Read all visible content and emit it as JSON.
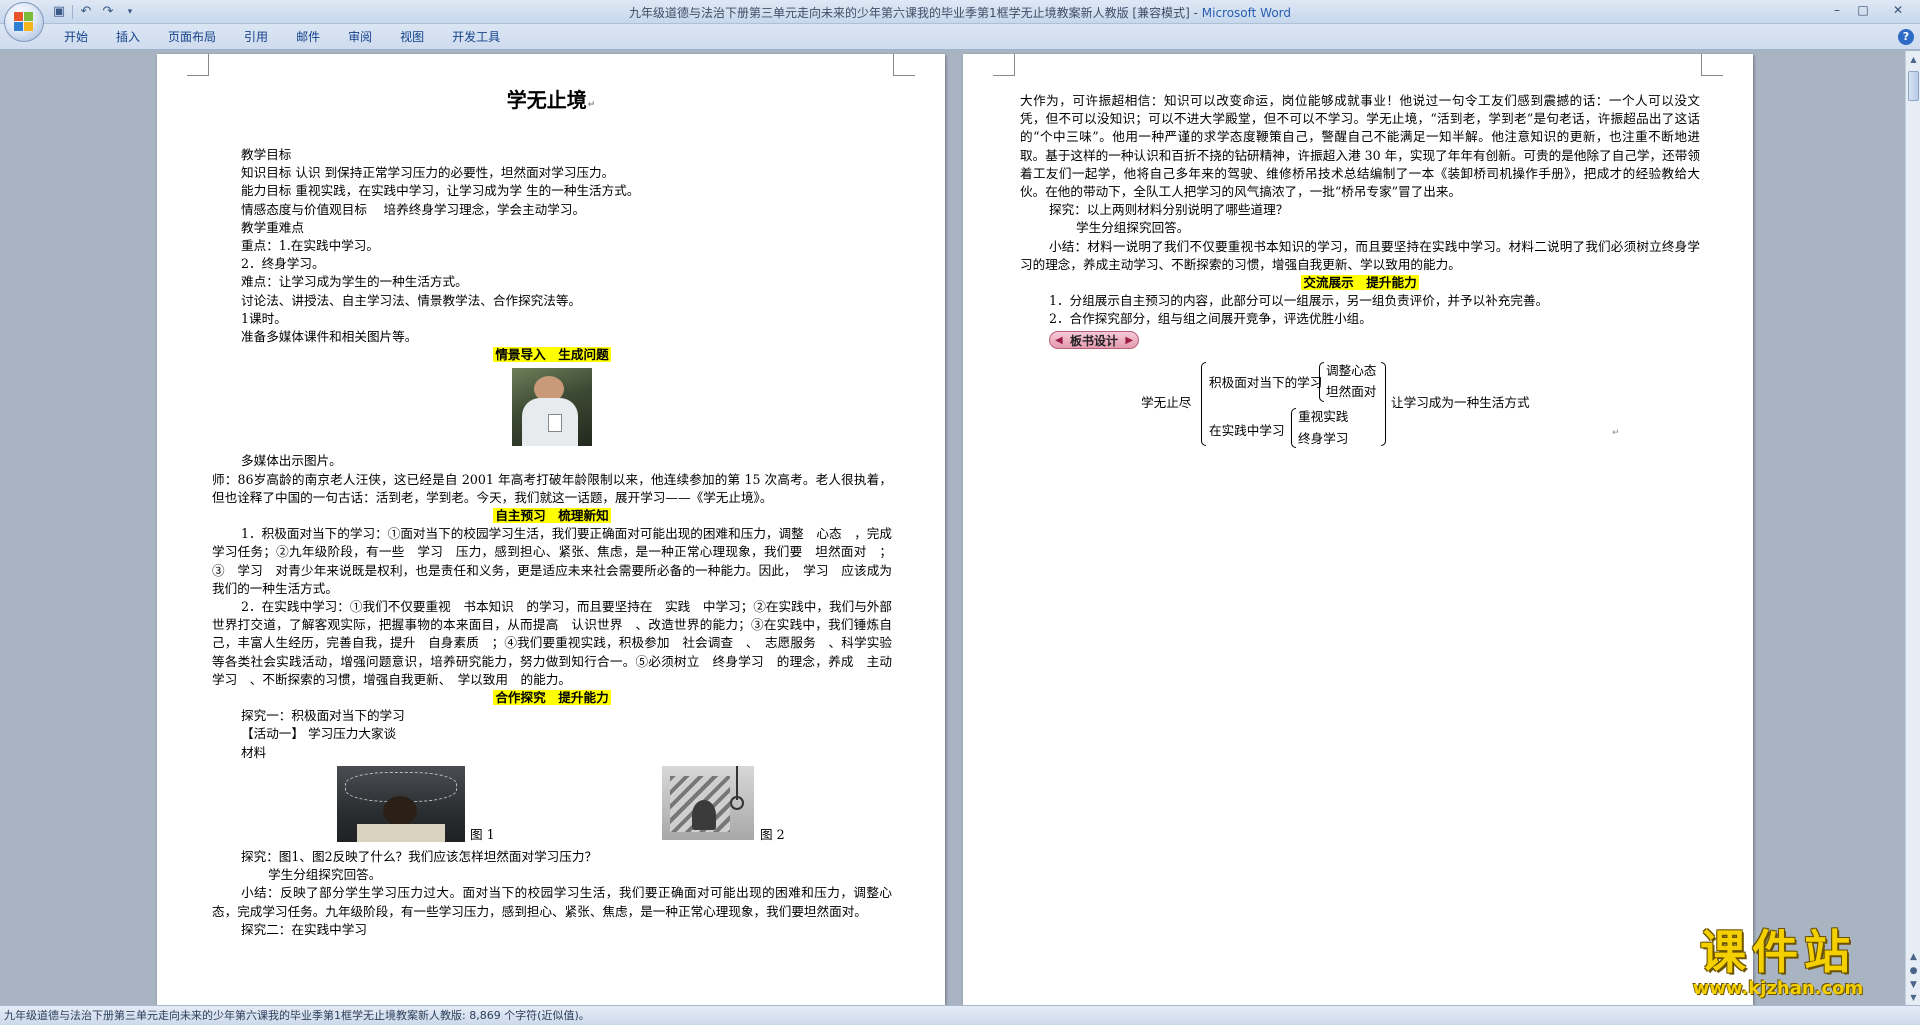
{
  "window": {
    "title": "九年级道德与法治下册第三单元走向未来的少年第六课我的毕业季第1框学无止境教案新人教版 [兼容模式] - ",
    "app_name": "Microsoft Word",
    "qat_icons": [
      "save-icon",
      "undo-icon",
      "redo-icon",
      "customize-icon"
    ],
    "controls": [
      "minimize-icon",
      "maximize-icon",
      "close-icon"
    ]
  },
  "ribbon": {
    "tabs": [
      "开始",
      "插入",
      "页面布局",
      "引用",
      "邮件",
      "审阅",
      "视图",
      "开发工具"
    ]
  },
  "page1": {
    "title": "学无止境",
    "lines_a": [
      "教学目标",
      "知识目标 认识 到保持正常学习压力的必要性，坦然面对学习压力。",
      "能力目标 重视实践，在实践中学习，让学习成为学 生的一种生活方式。",
      "情感态度与价值观目标　 培养终身学习理念，学会主动学习。",
      "教学重难点",
      "重点：1.在实践中学习。",
      "2．终身学习。",
      "难点：让学习成为学生的一种生活方式。",
      "讨论法、讲授法、自主学习法、情景教学法、合作探究法等。",
      "1课时。",
      "准备多媒体课件和相关图片等。"
    ],
    "section1": "情景导入　生成问题",
    "media_caption": "多媒体出示图片。",
    "teacher_text": "师：86岁高龄的南京老人汪侠，这已经是自 2001 年高考打破年龄限制以来，他连续参加的第 15 次高考。老人很执着，但也诠释了中国的一句古话：活到老，学到老。今天，我们就这一话题，展开学习——《学无止境》。",
    "section2": "自主预习　梳理新知",
    "item1": "1．积极面对当下的学习：①面对当下的校园学习生活，我们要正确面对可能出现的困难和压力，调整　心态　，完成学习任务；②九年级阶段，有一些　学习　压力，感到担心、紧张、焦虑，是一种正常心理现象，我们要　坦然面对　；③　学习　对青少年来说既是权利，也是责任和义务，更是适应未来社会需要所必备的一种能力。因此，　学习　应该成为我们的一种生活方式。",
    "item2": "2．在实践中学习：①我们不仅要重视　书本知识　的学习，而且要坚持在　实践　中学习；②在实践中，我们与外部世界打交道，了解客观实际，把握事物的本来面目，从而提高　认识世界　、改造世界的能力；③在实践中，我们锤炼自己，丰富人生经历，完善自我，提升　自身素质　；④我们要重视实践，积极参加　社会调查　、　志愿服务　、科学实验等各类社会实践活动，增强问题意识，培养研究能力，努力做到知行合一。⑤必须树立　终身学习　的理念，养成　主动学习　、不断探索的习惯，增强自我更新、　学以致用　的能力。",
    "section3": "合作探究　提升能力",
    "explore1": "探究一：积极面对当下的学习",
    "activity1": "【活动一】 学习压力大家谈",
    "material": "材料",
    "fig1": "图 1",
    "fig2": "图 2",
    "question1": "探究：图1、图2反映了什么？我们应该怎样坦然面对学习压力？",
    "answer1": "学生分组探究回答。",
    "summary1": "小结：反映了部分学生学习压力过大。面对当下的校园学习生活，我们要正确面对可能出现的困难和压力，调整心态，完成学习任务。九年级阶段，有一些学习压力，感到担心、紧张、焦虑，是一种正常心理现象，我们要坦然面对。",
    "explore2": "探究二：在实践中学习"
  },
  "page2": {
    "para1": "大作为，可许振超相信：知识可以改变命运，岗位能够成就事业！他说过一句令工友们感到震撼的话：一个人可以没文凭，但不可以没知识；可以不进大学殿堂，但不可以不学习。学无止境，“活到老，学到老”是句老话，许振超品出了这话的“个中三味”。他用一种严谨的求学态度鞭策自己，警醒自己不能满足一知半解。他注意知识的更新，也注重不断地进取。基于这样的一种认识和百折不挠的钻研精神，许振超入港 30 年，实现了年年有创新。可贵的是他除了自己学，还带领着工友们一起学，他将自己多年来的驾驶、维修桥吊技术总结编制了一本《装卸桥司机操作手册》，把成才的经验教给大伙。在他的带动下，全队工人把学习的风气搞浓了，一批“桥吊专家”冒了出来。",
    "question": "探究：以上两则材料分别说明了哪些道理？",
    "answer": "学生分组探究回答。",
    "summary": "小结：材料一说明了我们不仅要重视书本知识的学习，而且要坚持在实践中学习。材料二说明了我们必须树立终身学习的理念，养成主动学习、不断探索的习惯，增强自我更新、学以致用的能力。",
    "section4": "交流展示　提升能力",
    "show1": "1．分组展示自主预习的内容，此部分可以一组展示，另一组负责评价，并予以补充完善。",
    "show2": "2．合作探究部分，组与组之间展开竞争，评选优胜小组。",
    "board_title": "板书设计",
    "board": {
      "root": "学无止尽",
      "branch1": "积极面对当下的学习",
      "leaf1a": "调整心态",
      "leaf1b": "坦然面对",
      "branch2": "在实践中学习",
      "leaf2a": "重视实践",
      "leaf2b": "终身学习",
      "result": "让学习成为一种生活方式"
    }
  },
  "statusbar": {
    "text": "九年级道德与法治下册第三单元走向未来的少年第六课我的毕业季第1框学无止境教案新人教版: 8,869 个字符(近似值)。"
  },
  "watermark": {
    "text": "课件站",
    "url": "www.kjzhan.com"
  }
}
